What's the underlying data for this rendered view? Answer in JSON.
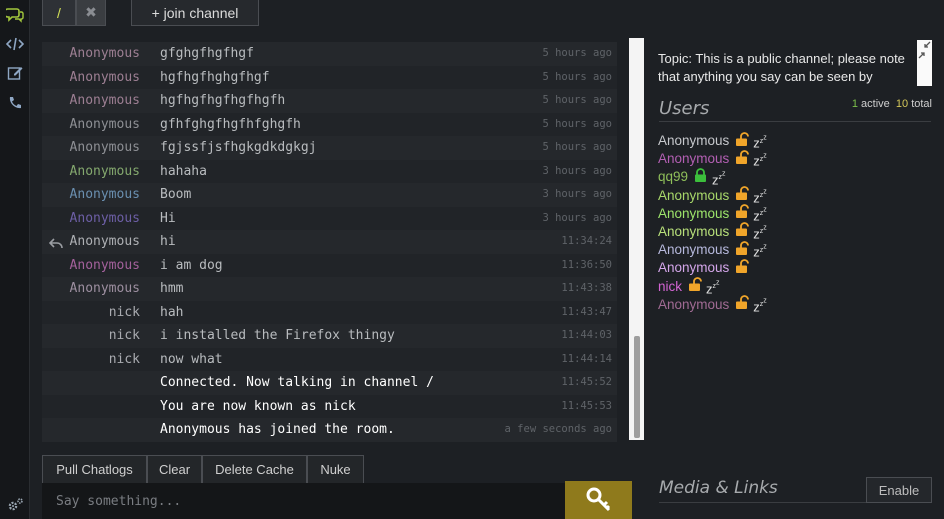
{
  "rail": {
    "icons": [
      "chat-bubbles-icon",
      "code-icon",
      "edit-icon",
      "phone-icon",
      "settings-icon"
    ]
  },
  "tabs": {
    "channel": "/",
    "close": "✖",
    "join": "+ join channel"
  },
  "log": [
    {
      "nick": "Anonymous",
      "color": "#9d7f93",
      "text": "gfghgfhgfhgf",
      "time": "5 hours ago"
    },
    {
      "nick": "Anonymous",
      "color": "#9d7f93",
      "text": "hgfhgfhghgfhgf",
      "time": "5 hours ago"
    },
    {
      "nick": "Anonymous",
      "color": "#9d7f93",
      "text": "hgfhgfhgfhgfhgfh",
      "time": "5 hours ago"
    },
    {
      "nick": "Anonymous",
      "color": "#8d8f94",
      "text": "gfhfghgfhgfhfghgfh",
      "time": "5 hours ago"
    },
    {
      "nick": "Anonymous",
      "color": "#8d8f94",
      "text": "fgjssfjsfhgkgdkdgkgj",
      "time": "5 hours ago"
    },
    {
      "nick": "Anonymous",
      "color": "#84a86e",
      "text": "hahaha",
      "time": "3 hours ago"
    },
    {
      "nick": "Anonymous",
      "color": "#6a8fb0",
      "text": "Boom",
      "time": "3 hours ago"
    },
    {
      "nick": "Anonymous",
      "color": "#6d5fa6",
      "text": "Hi",
      "time": "3 hours ago"
    },
    {
      "nick": "Anonymous",
      "color": "#aeb0b4",
      "text": "hi",
      "time": "11:34:24",
      "reply": true
    },
    {
      "nick": "Anonymous",
      "color": "#a4619c",
      "text": "i am dog",
      "time": "11:36:50"
    },
    {
      "nick": "Anonymous",
      "color": "#9d8fa0",
      "text": "hmm",
      "time": "11:43:38"
    },
    {
      "nick": "nick",
      "color": "#a9abb0",
      "text": "hah",
      "time": "11:43:47"
    },
    {
      "nick": "nick",
      "color": "#a9abb0",
      "text": "i installed the Firefox thingy",
      "time": "11:44:03"
    },
    {
      "nick": "nick",
      "color": "#a9abb0",
      "text": "now what",
      "time": "11:44:14"
    },
    {
      "nick": "",
      "color": "#ffffff",
      "text": "Connected. Now talking in channel /",
      "time": "11:45:52",
      "system": true
    },
    {
      "nick": "",
      "color": "#ffffff",
      "text": "You are now known as nick",
      "time": "11:45:53",
      "system": true
    },
    {
      "nick": "",
      "color": "#ffffff",
      "text": "Anonymous has joined the room.",
      "time": "a few seconds ago",
      "system": true
    }
  ],
  "controls": {
    "pull": "Pull Chatlogs",
    "clear": "Clear",
    "delete": "Delete Cache",
    "nuke": "Nuke",
    "placeholder": "Say something..."
  },
  "topic": "Topic: This is a public channel; please note that anything you say can be seen by",
  "users": {
    "title": "Users",
    "active": "1",
    "active_label": "active",
    "total": "10",
    "total_label": "total",
    "list": [
      {
        "name": "Anonymous",
        "color": "#c6c8cc",
        "lock": "open",
        "sleep": true
      },
      {
        "name": "Anonymous",
        "color": "#b35fb3",
        "lock": "open",
        "sleep": true
      },
      {
        "name": "qq99",
        "color": "#8fbf5a",
        "lock": "closed",
        "sleep": true
      },
      {
        "name": "Anonymous",
        "color": "#a8d86a",
        "lock": "open",
        "sleep": true
      },
      {
        "name": "Anonymous",
        "color": "#9ee66b",
        "lock": "open",
        "sleep": true
      },
      {
        "name": "Anonymous",
        "color": "#b8e07a",
        "lock": "open",
        "sleep": true
      },
      {
        "name": "Anonymous",
        "color": "#b7b9dd",
        "lock": "open",
        "sleep": true
      },
      {
        "name": "Anonymous",
        "color": "#d4a6ea",
        "lock": "open",
        "sleep": false
      },
      {
        "name": "nick",
        "color": "#d264d2",
        "lock": "open",
        "sleep": true
      },
      {
        "name": "Anonymous",
        "color": "#a16b94",
        "lock": "open",
        "sleep": true
      }
    ]
  },
  "media": {
    "title": "Media & Links",
    "enable": "Enable"
  },
  "colors": {
    "accent": "#d4e157",
    "send": "#8f7a1c",
    "lock_open": "#f0a52a",
    "lock_closed": "#3cbf3c"
  }
}
